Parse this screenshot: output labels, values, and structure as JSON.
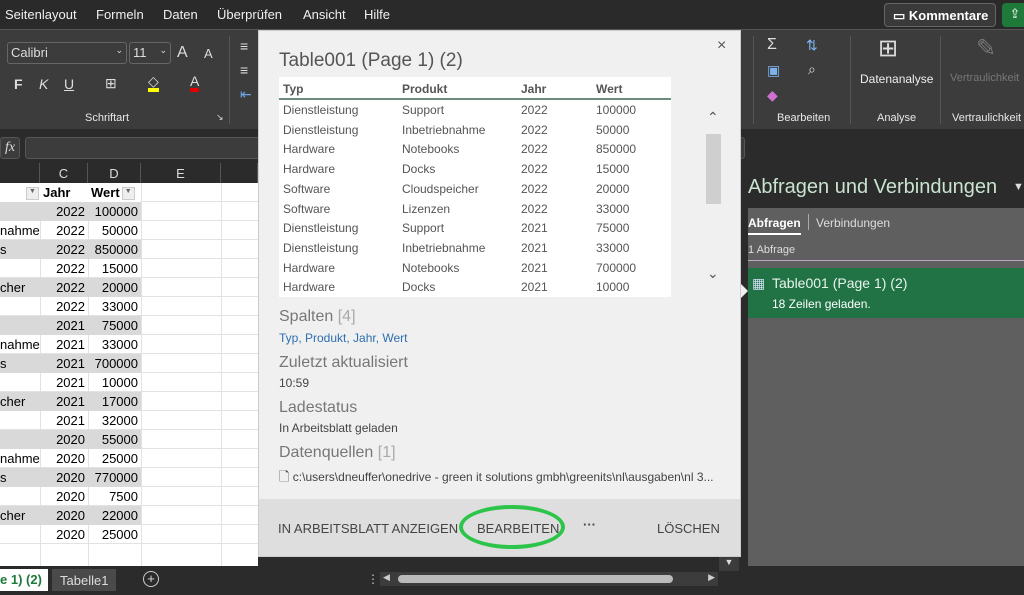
{
  "menu": {
    "items": [
      "Seitenlayout",
      "Formeln",
      "Daten",
      "Überprüfen",
      "Ansicht",
      "Hilfe"
    ],
    "kommentare": "Kommentare"
  },
  "ribbon": {
    "font_name": "Calibri",
    "font_size": "11",
    "bold": "F",
    "italic": "K",
    "underline": "U",
    "schriftart_label": "Schriftart",
    "bearbeiten_label": "Bearbeiten",
    "datenanalyse": "Datenanalyse",
    "analyse_label": "Analyse",
    "vertraulichkeit_btn": "Vertraulichkeit",
    "vertraulichkeit_label": "Vertraulichkeit",
    "colors": {
      "highlight": "#ffff00",
      "font_color": "#ff0000"
    }
  },
  "formula_bar": {
    "fx": "fx",
    "value": ""
  },
  "columns": [
    "C",
    "D",
    "E"
  ],
  "sheet": {
    "header": {
      "c": "Jahr",
      "d": "Wert"
    },
    "rows": [
      {
        "b": "",
        "c": "2022",
        "d": "100000"
      },
      {
        "b": "nahme",
        "c": "2022",
        "d": "50000"
      },
      {
        "b": "s",
        "c": "2022",
        "d": "850000"
      },
      {
        "b": "",
        "c": "2022",
        "d": "15000"
      },
      {
        "b": "cher",
        "c": "2022",
        "d": "20000"
      },
      {
        "b": "",
        "c": "2022",
        "d": "33000"
      },
      {
        "b": "",
        "c": "2021",
        "d": "75000"
      },
      {
        "b": "nahme",
        "c": "2021",
        "d": "33000"
      },
      {
        "b": "s",
        "c": "2021",
        "d": "700000"
      },
      {
        "b": "",
        "c": "2021",
        "d": "10000"
      },
      {
        "b": "cher",
        "c": "2021",
        "d": "17000"
      },
      {
        "b": "",
        "c": "2021",
        "d": "32000"
      },
      {
        "b": "",
        "c": "2020",
        "d": "55000"
      },
      {
        "b": "nahme",
        "c": "2020",
        "d": "25000"
      },
      {
        "b": "s",
        "c": "2020",
        "d": "770000"
      },
      {
        "b": "",
        "c": "2020",
        "d": "7500"
      },
      {
        "b": "cher",
        "c": "2020",
        "d": "22000"
      },
      {
        "b": "",
        "c": "2020",
        "d": "25000"
      }
    ]
  },
  "sheet_tabs": {
    "active": "e 1) (2)",
    "other": "Tabelle1",
    "add": "+"
  },
  "popup": {
    "title": "Table001 (Page 1) (2)",
    "close": "×",
    "columns": [
      "Typ",
      "Produkt",
      "Jahr",
      "Wert"
    ],
    "rows": [
      [
        "Dienstleistung",
        "Support",
        "2022",
        "100000"
      ],
      [
        "Dienstleistung",
        "Inbetriebnahme",
        "2022",
        "50000"
      ],
      [
        "Hardware",
        "Notebooks",
        "2022",
        "850000"
      ],
      [
        "Hardware",
        "Docks",
        "2022",
        "15000"
      ],
      [
        "Software",
        "Cloudspeicher",
        "2022",
        "20000"
      ],
      [
        "Software",
        "Lizenzen",
        "2022",
        "33000"
      ],
      [
        "Dienstleistung",
        "Support",
        "2021",
        "75000"
      ],
      [
        "Dienstleistung",
        "Inbetriebnahme",
        "2021",
        "33000"
      ],
      [
        "Hardware",
        "Notebooks",
        "2021",
        "700000"
      ],
      [
        "Hardware",
        "Docks",
        "2021",
        "10000"
      ]
    ],
    "spalten_label": "Spalten",
    "spalten_count": "[4]",
    "spalten_value": "Typ, Produkt, Jahr, Wert",
    "zuletzt_label": "Zuletzt aktualisiert",
    "zuletzt_value": "10:59",
    "ladestatus_label": "Ladestatus",
    "ladestatus_value": "In Arbeitsblatt geladen",
    "datenquellen_label": "Datenquellen",
    "datenquellen_count": "[1]",
    "datenquellen_value": "c:\\users\\dneuffer\\onedrive - green it solutions gmbh\\greenits\\nl\\ausgaben\\nl 3...",
    "footer": {
      "anzeigen": "IN ARBEITSBLATT ANZEIGEN",
      "bearbeiten": "BEARBEITEN",
      "more": "···",
      "loeschen": "LÖSCHEN"
    }
  },
  "side_panel": {
    "title": "Abfragen und Verbindungen",
    "tabs": [
      "Abfragen",
      "Verbindungen"
    ],
    "count": "1 Abfrage",
    "query_name": "Table001 (Page 1) (2)",
    "query_status": "18 Zeilen geladen.",
    "accent": "#217346"
  }
}
